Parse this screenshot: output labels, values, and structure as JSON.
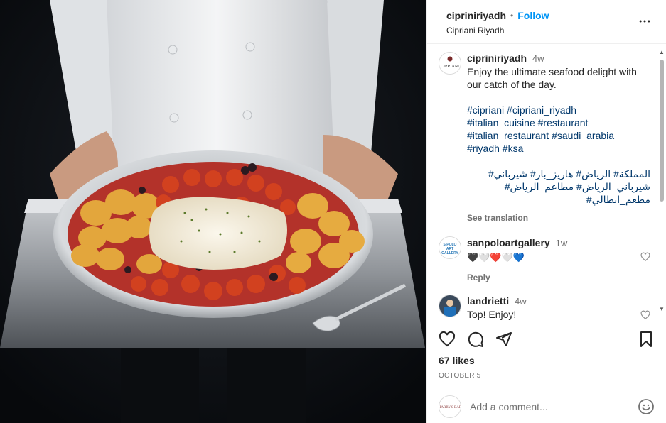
{
  "post": {
    "username": "cipriani riyadh",
    "author": "cipriniriyadh",
    "follow_label": "Follow",
    "separator": "•",
    "location": "Cipriani Riyadh",
    "image_alt": "Chef holding a silver tray with baked fish, roasted potatoes and cherry tomatoes"
  },
  "caption": {
    "avatar_text": "CIPRIANI",
    "username": "cipriniriyadh",
    "time": "4w",
    "text": "Enjoy the ultimate seafood delight with our catch of the day.",
    "hashtags_1": "#cipriani #cipriani_riyadh",
    "hashtags_2": "#italian_cuisine #restaurant",
    "hashtags_3": "#italian_restaurant #saudi_arabia",
    "hashtags_4": "#riyadh #ksa",
    "arabic_1": "المملكة# الرياض# هاريز_بار# شيرباني#",
    "arabic_2": "شيرباني_الرياض# مطاعم_الرياض#",
    "arabic_3": "مطعم_ايطالي#",
    "see_translation": "See translation"
  },
  "comments": [
    {
      "username": "sanpoloartgallery",
      "time": "1w",
      "avatar_text": "S.POLO ART GALLERY",
      "text": "🖤🤍❤️🤍💙",
      "reply_label": "Reply"
    },
    {
      "username": "landrietti",
      "time": "4w",
      "text": "Top! Enjoy!"
    }
  ],
  "actions": {
    "likes": "67 likes",
    "date": "OCTOBER 5"
  },
  "add_comment": {
    "placeholder": "Add a comment...",
    "my_avatar_text": "HARRY'S BAR"
  },
  "icons": {
    "like": "heart-icon",
    "comment": "comment-icon",
    "share": "share-icon",
    "save": "bookmark-icon",
    "more": "more-icon",
    "emoji": "emoji-icon"
  },
  "colors": {
    "link": "#0095f6",
    "hashtag": "#00376b",
    "muted": "#737373"
  }
}
